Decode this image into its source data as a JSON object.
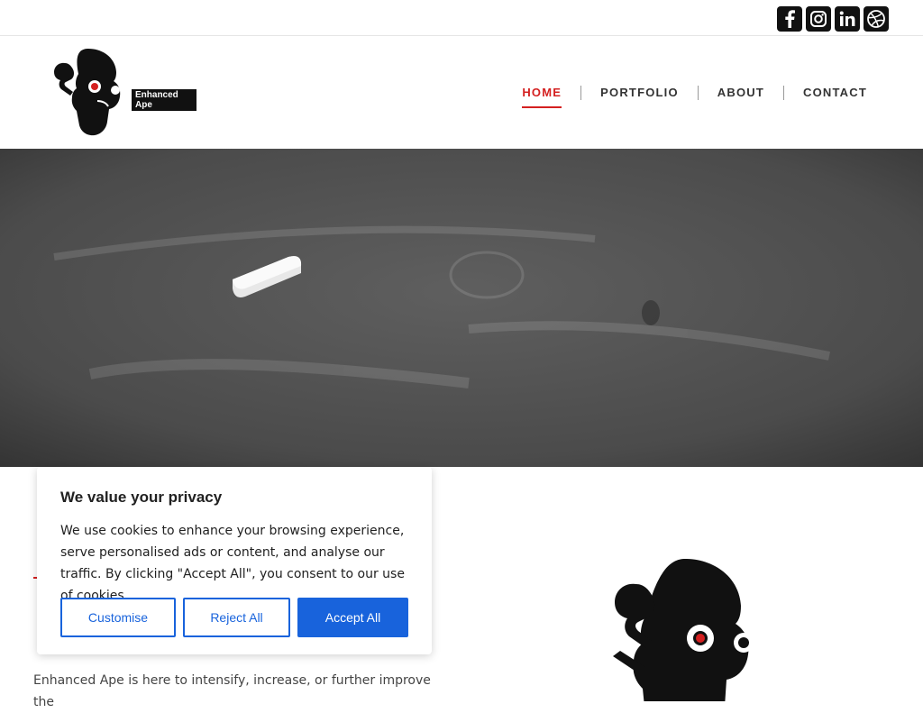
{
  "social": {
    "items": [
      {
        "name": "facebook-icon"
      },
      {
        "name": "instagram-icon"
      },
      {
        "name": "linkedin-icon"
      },
      {
        "name": "dribbble-icon"
      }
    ]
  },
  "brand": {
    "logo_text": "Enhanced Ape"
  },
  "nav": {
    "items": [
      {
        "label": "HOME",
        "active": true
      },
      {
        "label": "PORTFOLIO",
        "active": false
      },
      {
        "label": "ABOUT",
        "active": false
      },
      {
        "label": "CONTACT",
        "active": false
      }
    ],
    "accent": "#d42020"
  },
  "content": {
    "para": "Enhanced Ape is here to intensify, increase, or further improve the"
  },
  "cookie": {
    "title": "We value your privacy",
    "body": "We use cookies to enhance your browsing experience, serve personalised ads or content, and analyse our traffic. By clicking \"Accept All\", you consent to our use of cookies.",
    "customise_label": "Customise",
    "reject_label": "Reject All",
    "accept_label": "Accept All",
    "accent": "#1863dc"
  }
}
